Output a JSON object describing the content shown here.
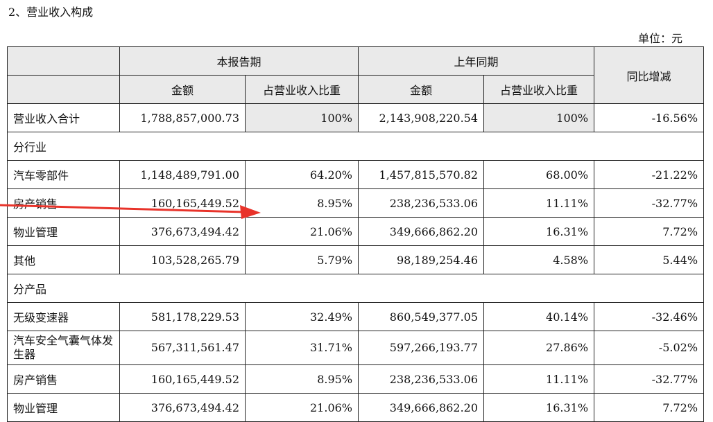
{
  "heading": "2、营业收入构成",
  "unit": "单位：元",
  "header": {
    "current_period": "本报告期",
    "prior_period": "上年同期",
    "yoy": "同比增减",
    "amount": "金额",
    "ratio": "占营业收入比重"
  },
  "total": {
    "label": "营业收入合计",
    "cur_amount": "1,788,857,000.73",
    "cur_ratio": "100%",
    "prev_amount": "2,143,908,220.54",
    "prev_ratio": "100%",
    "yoy": "-16.56%"
  },
  "by_industry": {
    "title": "分行业",
    "rows": [
      {
        "label": "汽车零部件",
        "cur_amount": "1,148,489,791.00",
        "cur_ratio": "64.20%",
        "prev_amount": "1,457,815,570.82",
        "prev_ratio": "68.00%",
        "yoy": "-21.22%"
      },
      {
        "label": "房产销售",
        "cur_amount": "160,165,449.52",
        "cur_ratio": "8.95%",
        "prev_amount": "238,236,533.06",
        "prev_ratio": "11.11%",
        "yoy": "-32.77%"
      },
      {
        "label": "物业管理",
        "cur_amount": "376,673,494.42",
        "cur_ratio": "21.06%",
        "prev_amount": "349,666,862.20",
        "prev_ratio": "16.31%",
        "yoy": "7.72%"
      },
      {
        "label": "其他",
        "cur_amount": "103,528,265.79",
        "cur_ratio": "5.79%",
        "prev_amount": "98,189,254.46",
        "prev_ratio": "4.58%",
        "yoy": "5.44%"
      }
    ]
  },
  "by_product": {
    "title": "分产品",
    "rows": [
      {
        "label": "无级变速器",
        "cur_amount": "581,178,229.53",
        "cur_ratio": "32.49%",
        "prev_amount": "860,549,377.05",
        "prev_ratio": "40.14%",
        "yoy": "-32.46%"
      },
      {
        "label": "汽车安全气囊气体发生器",
        "cur_amount": "567,311,561.47",
        "cur_ratio": "31.71%",
        "prev_amount": "597,266,193.77",
        "prev_ratio": "27.86%",
        "yoy": "-5.02%"
      },
      {
        "label": "房产销售",
        "cur_amount": "160,165,449.52",
        "cur_ratio": "8.95%",
        "prev_amount": "238,236,533.06",
        "prev_ratio": "11.11%",
        "yoy": "-32.77%"
      },
      {
        "label": "物业管理",
        "cur_amount": "376,673,494.42",
        "cur_ratio": "21.06%",
        "prev_amount": "349,666,862.20",
        "prev_ratio": "16.31%",
        "yoy": "7.72%"
      }
    ]
  },
  "colors": {
    "header_bg": "#eaeaea",
    "arrow": "#e8332a"
  }
}
